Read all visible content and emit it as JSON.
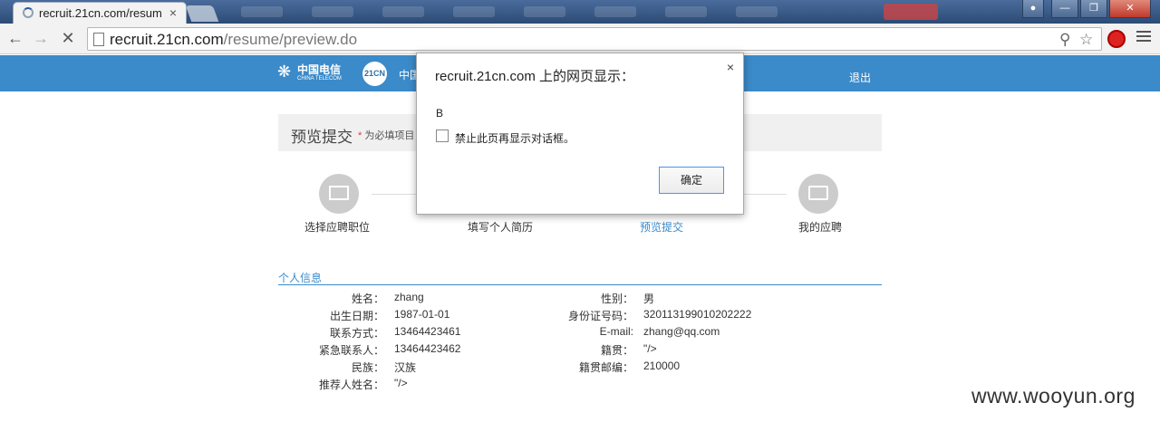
{
  "browser": {
    "tab_title": "recruit.21cn.com/resum",
    "tab_close": "×",
    "url_host": "recruit.21cn.com",
    "url_path": "/resume/preview.do",
    "icons": {
      "back": "back-arrow-icon",
      "forward": "forward-arrow-icon",
      "stop": "stop-icon",
      "search": "search-icon",
      "star": "star-icon",
      "menu": "menu-icon"
    }
  },
  "header": {
    "brand_name": "中国电信",
    "brand_en": "CHINA TELECOM",
    "badge": "21CN",
    "text": "中国",
    "logout": "退出",
    "color": "#3b8ac9"
  },
  "preview": {
    "title": "预览提交",
    "required_star": "*",
    "required_note": "为必填项目"
  },
  "steps": [
    {
      "label": "选择应聘职位",
      "active": false
    },
    {
      "label": "填写个人简历",
      "active": false
    },
    {
      "label": "预览提交",
      "active": true
    },
    {
      "label": "我的应聘",
      "active": false
    }
  ],
  "section": {
    "title": "个人信息"
  },
  "personal_info": {
    "left": [
      {
        "label": "姓名：",
        "value": "zhang"
      },
      {
        "label": "出生日期：",
        "value": "1987-01-01"
      },
      {
        "label": "联系方式：",
        "value": "13464423461"
      },
      {
        "label": "紧急联系人：",
        "value": "13464423462"
      },
      {
        "label": "民族：",
        "value": "汉族"
      },
      {
        "label": "推荐人姓名：",
        "value": "\"/>"
      }
    ],
    "right": [
      {
        "label": "性别：",
        "value": "男"
      },
      {
        "label": "身份证号码：",
        "value": "320113199010202222"
      },
      {
        "label": "E-mail:",
        "value": "zhang@qq.com"
      },
      {
        "label": "籍贯：",
        "value": "\"/>"
      },
      {
        "label": "籍贯邮编：",
        "value": "210000"
      }
    ]
  },
  "dialog": {
    "title": "recruit.21cn.com 上的网页显示：",
    "close": "×",
    "message": "B",
    "checkbox_label": "禁止此页再显示对话框。",
    "ok_label": "确定"
  },
  "watermark": "www.wooyun.org"
}
